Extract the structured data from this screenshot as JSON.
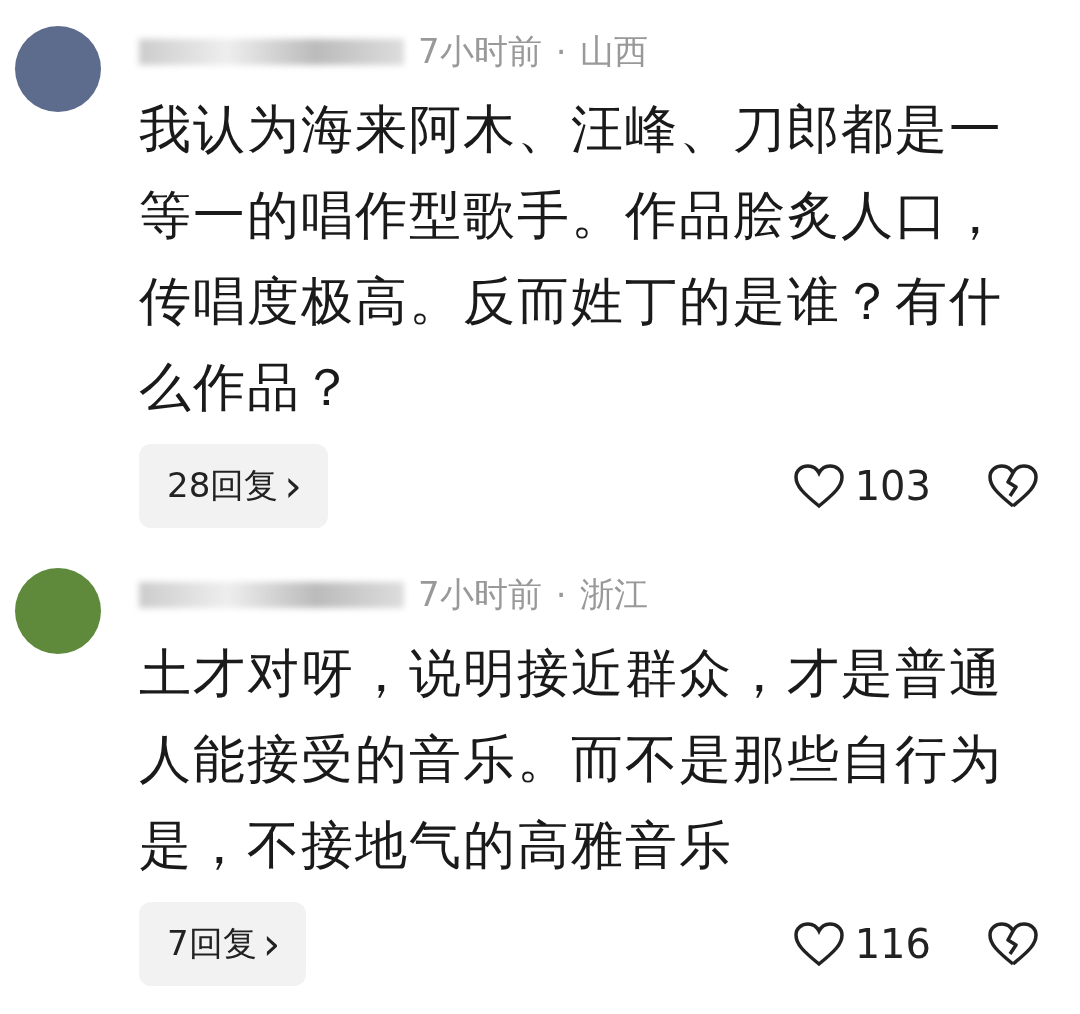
{
  "comments": [
    {
      "time": "7小时前",
      "separator": "·",
      "location": "山西",
      "text": "我认为海来阿木、汪峰、刀郎都是一等一的唱作型歌手。作品脍炙人口，传唱度极高。反而姓丁的是谁？有什么作品？",
      "replies": "28回复",
      "chevron": "›",
      "likes": "103",
      "liked": false
    },
    {
      "time": "7小时前",
      "separator": "·",
      "location": "浙江",
      "text": "土才对呀，说明接近群众，才是普通人能接受的音乐。而不是那些自行为是，不接地气的高雅音乐",
      "replies": "7回复",
      "chevron": "›",
      "likes": "116",
      "liked": false
    }
  ]
}
